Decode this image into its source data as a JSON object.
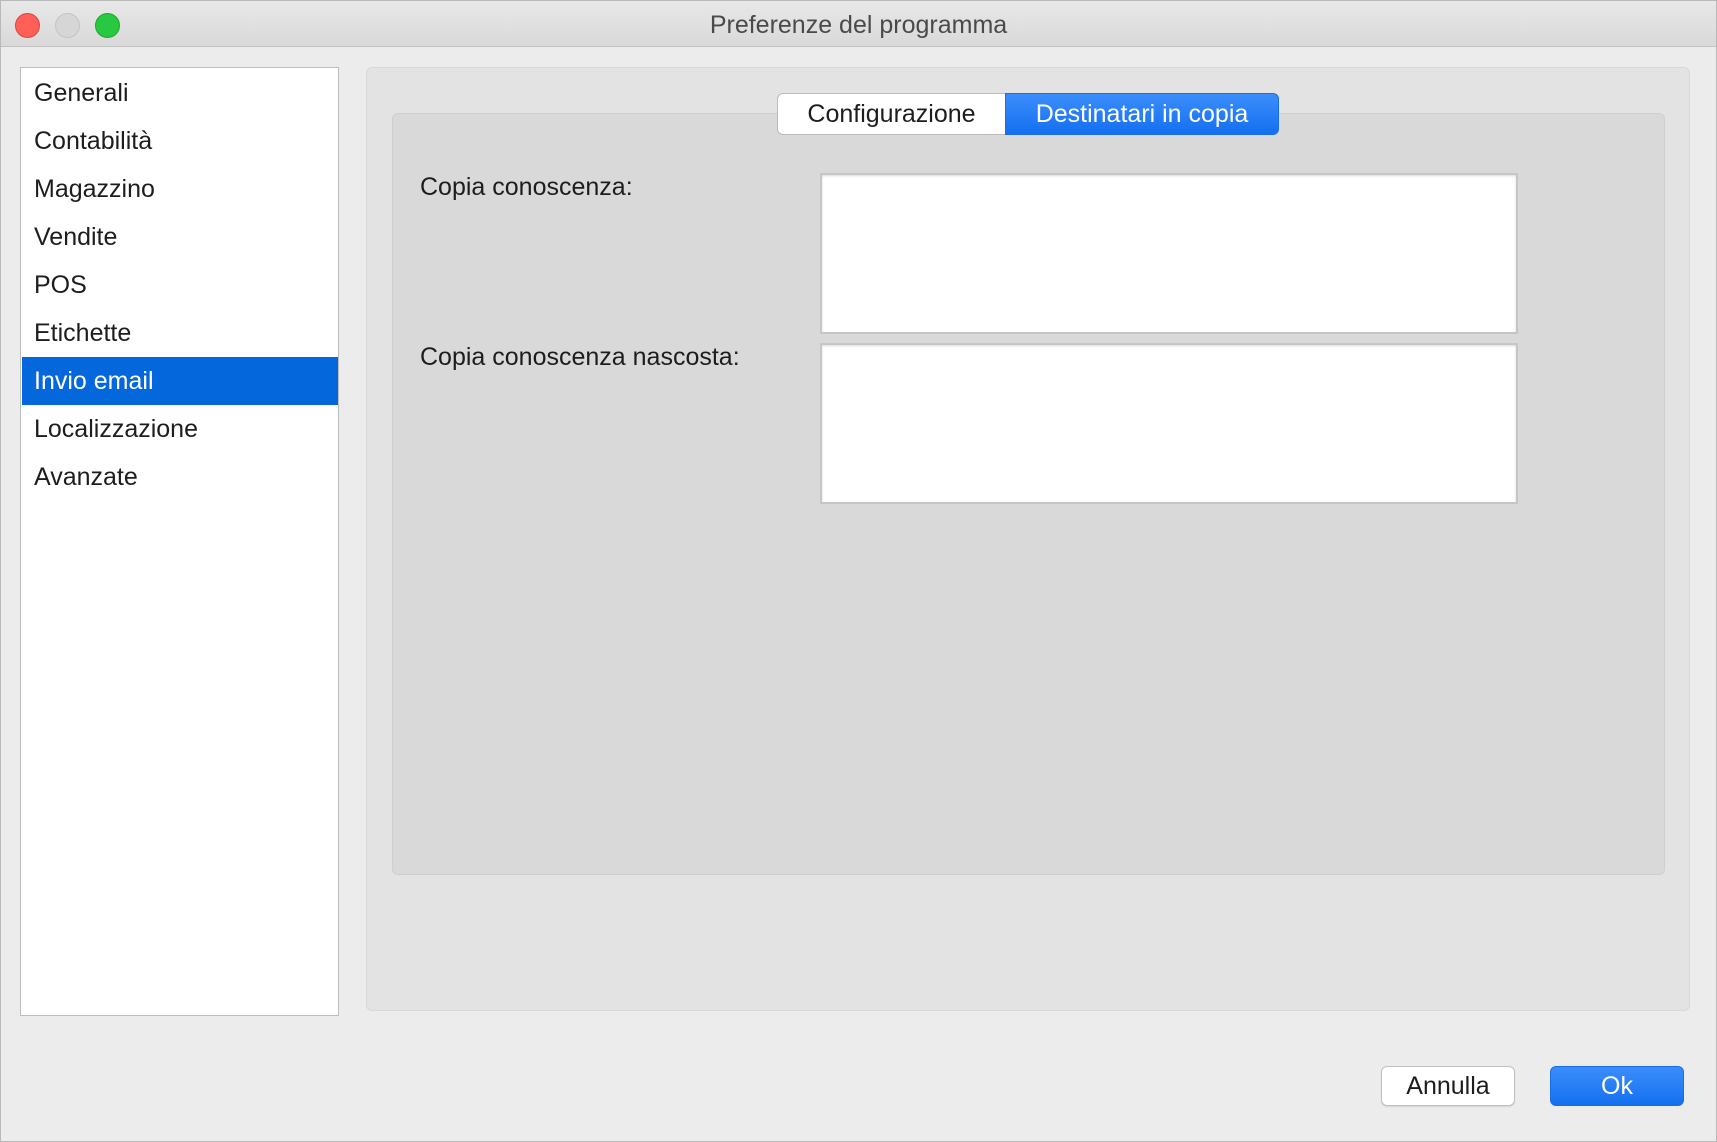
{
  "window": {
    "title": "Preferenze del programma"
  },
  "sidebar": {
    "items": [
      {
        "label": "Generali",
        "selected": false
      },
      {
        "label": "Contabilità",
        "selected": false
      },
      {
        "label": "Magazzino",
        "selected": false
      },
      {
        "label": "Vendite",
        "selected": false
      },
      {
        "label": "POS",
        "selected": false
      },
      {
        "label": "Etichette",
        "selected": false
      },
      {
        "label": "Invio email",
        "selected": true
      },
      {
        "label": "Localizzazione",
        "selected": false
      },
      {
        "label": "Avanzate",
        "selected": false
      }
    ]
  },
  "tabs": [
    {
      "label": "Configurazione",
      "active": false
    },
    {
      "label": "Destinatari in copia",
      "active": true
    }
  ],
  "form": {
    "cc_label": "Copia conoscenza:",
    "cc_value": "",
    "bcc_label": "Copia conoscenza nascosta:",
    "bcc_value": ""
  },
  "buttons": {
    "cancel_label": "Annulla",
    "ok_label": "Ok"
  },
  "colors": {
    "accent": "#0467dc",
    "close": "#fe5f57",
    "zoom": "#28c840"
  }
}
